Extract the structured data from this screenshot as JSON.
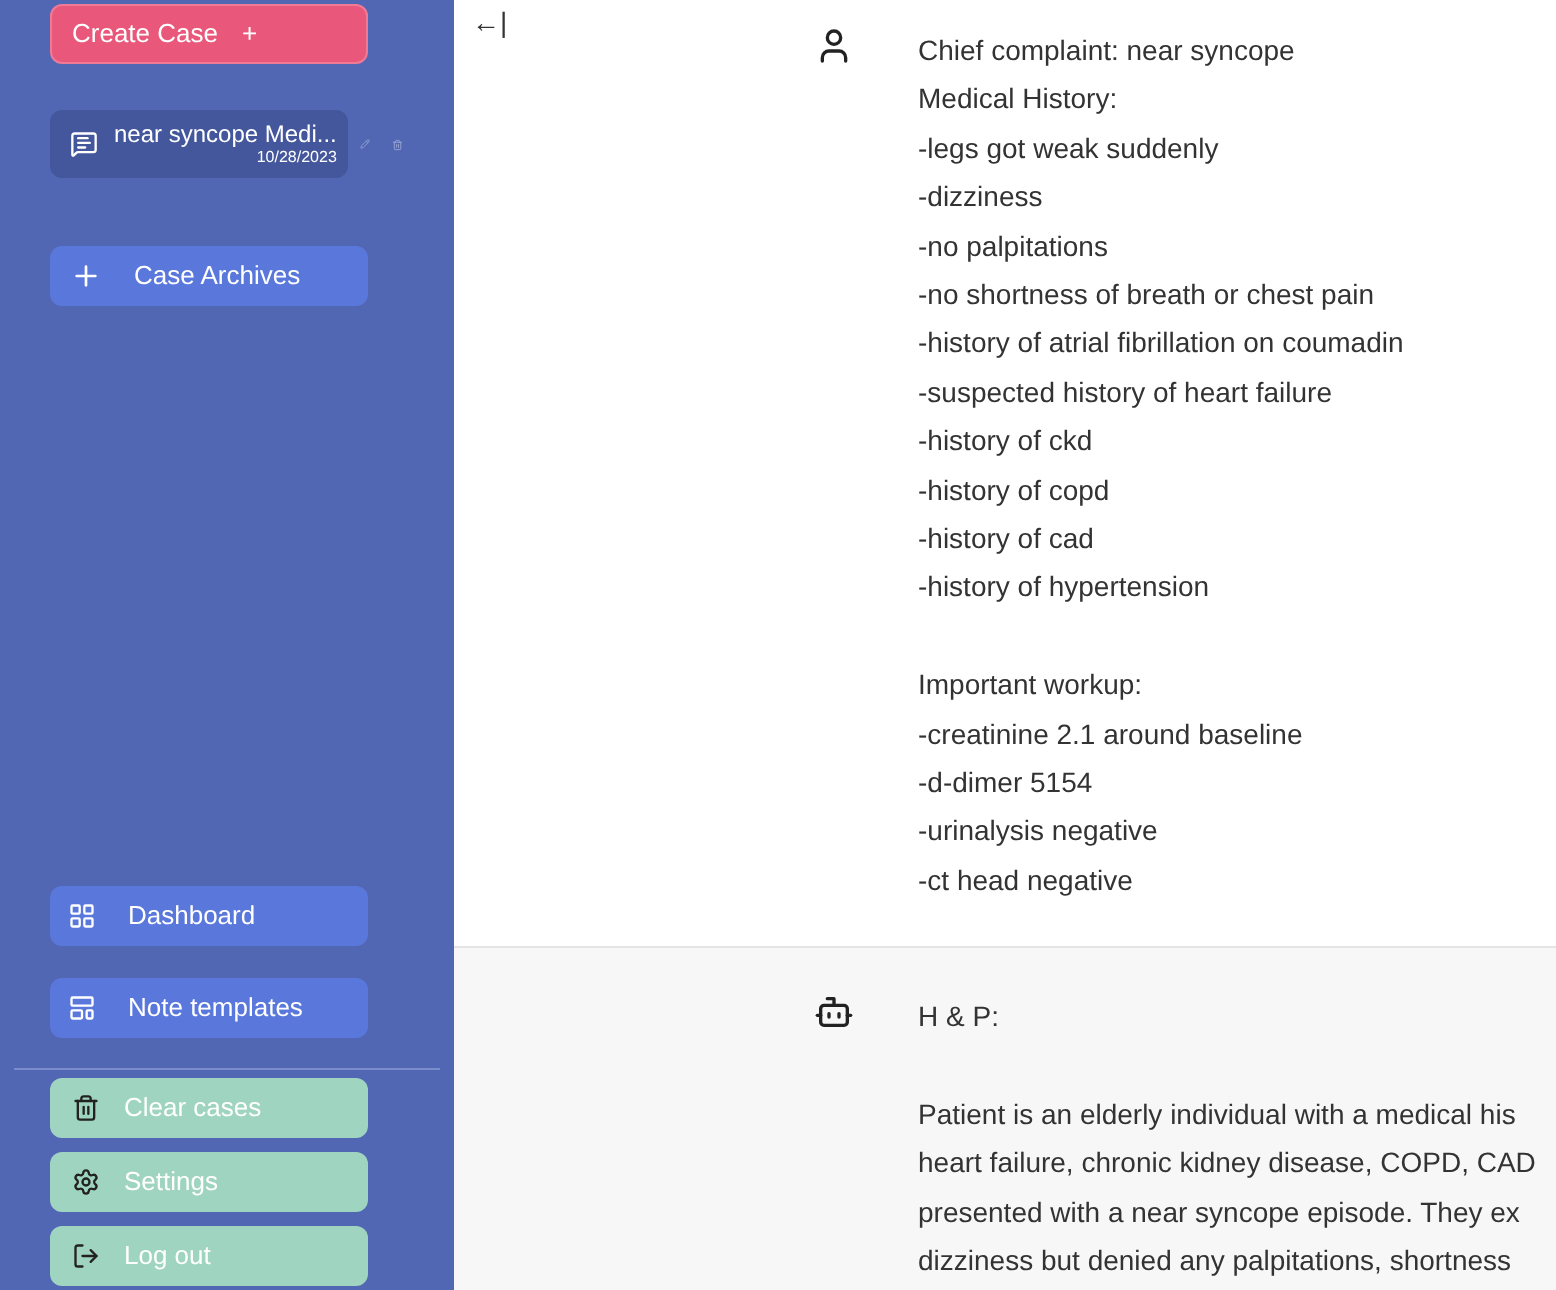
{
  "sidebar": {
    "create_button": {
      "label": "Create Case",
      "icon": "+"
    },
    "cases": [
      {
        "title": "near syncope Medi...",
        "date": "10/28/2023",
        "selected": true
      }
    ],
    "archives_button": {
      "label": "Case Archives"
    },
    "nav": [
      {
        "label": "Dashboard",
        "kind": "dashboard"
      },
      {
        "label": "Note templates",
        "kind": "template"
      }
    ],
    "actions": [
      {
        "label": "Clear cases",
        "kind": "clear"
      },
      {
        "label": "Settings",
        "kind": "settings"
      },
      {
        "label": "Log out",
        "kind": "logout"
      }
    ]
  },
  "collapse_button": {
    "label": "←|"
  },
  "messages": [
    {
      "kind": "user",
      "paragraphs": [
        [
          "Chief complaint: near syncope",
          "Medical History:",
          "-legs got weak suddenly",
          "-dizziness",
          "-no palpitations",
          "-no shortness of breath or chest pain",
          "-history of atrial fibrillation on coumadin",
          "-suspected history of heart failure",
          "-history of ckd",
          "-history of copd",
          "-history of cad",
          "-history of hypertension"
        ],
        [
          "Important workup:",
          "-creatinine 2.1 around baseline",
          "-d-dimer 5154",
          "-urinalysis negative",
          "-ct head negative"
        ]
      ]
    },
    {
      "kind": "assistant",
      "paragraphs": [
        [
          "H & P:"
        ],
        [
          "Patient is an elderly individual with a medical his",
          "heart failure, chronic kidney disease, COPD, CAD",
          "presented with a near syncope episode. They ex",
          "dizziness but denied any palpitations, shortness"
        ]
      ]
    }
  ]
}
